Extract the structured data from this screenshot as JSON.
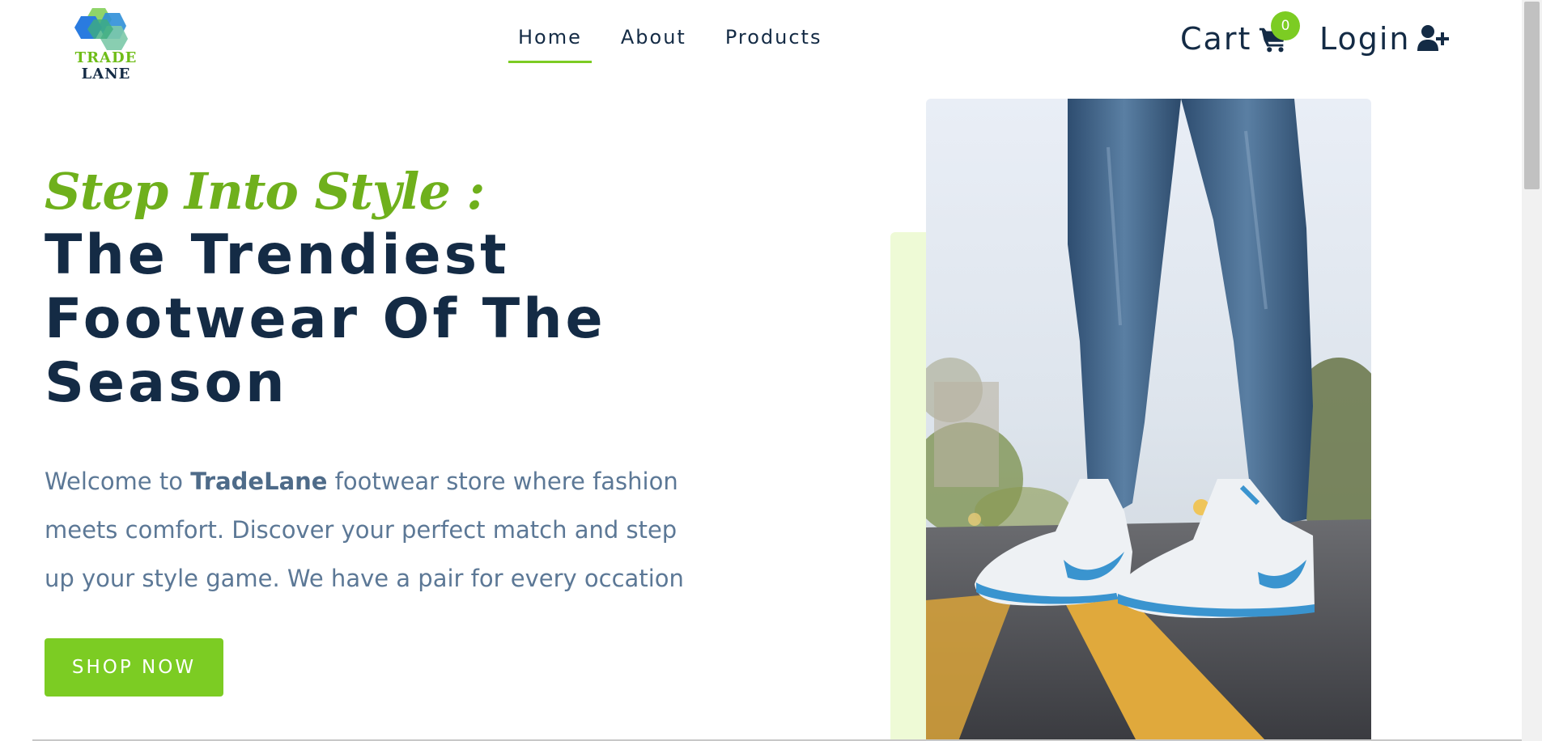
{
  "brand": {
    "logo_line1": "TRADE",
    "logo_line2": "LANE"
  },
  "nav": {
    "items": [
      {
        "label": "Home",
        "active": true
      },
      {
        "label": "About",
        "active": false
      },
      {
        "label": "Products",
        "active": false
      }
    ]
  },
  "header": {
    "cart_label": "Cart",
    "cart_count": "0",
    "cart_icon": "shopping-cart-icon",
    "login_label": "Login",
    "login_icon": "user-plus-icon"
  },
  "hero": {
    "tagline": "Step Into Style :",
    "headline_line1": "The Trendiest",
    "headline_line2": "Footwear Of The",
    "headline_line3": "Season",
    "intro_before": "Welcome to ",
    "intro_brand": "TradeLane",
    "intro_after": " footwear store where fashion meets comfort. Discover your perfect match and step up your style game. We have a pair for every occation",
    "cta_label": "SHOP NOW"
  },
  "colors": {
    "accent": "#7ccc23",
    "navy": "#142b45",
    "body_text": "#5c7896",
    "accent_panel": "#eefad6"
  }
}
